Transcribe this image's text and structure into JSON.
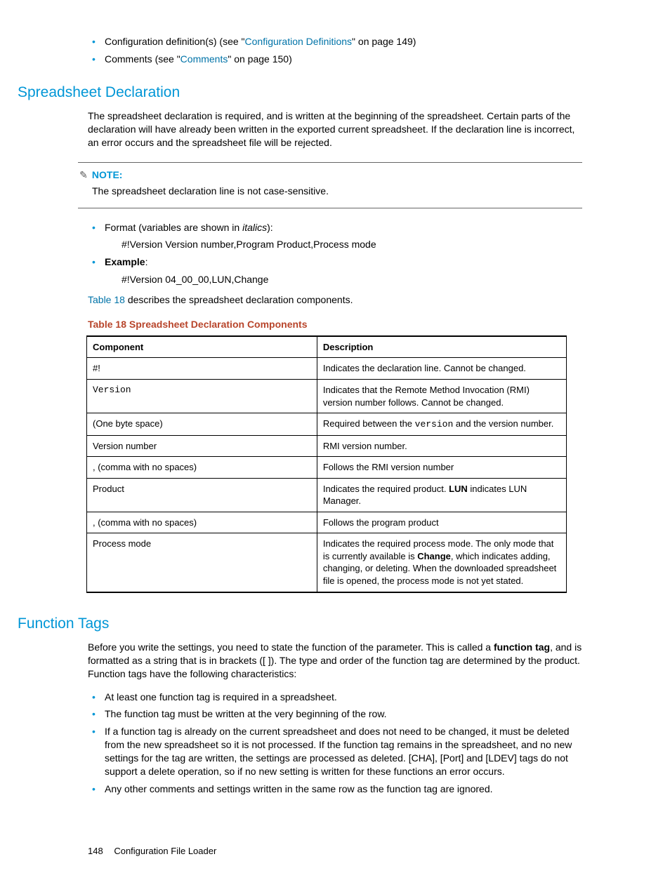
{
  "topList": {
    "item1_pre": "Configuration definition(s) (see \"",
    "item1_link": "Configuration Definitions",
    "item1_post": "\" on page 149)",
    "item2_pre": "Comments (see \"",
    "item2_link": "Comments",
    "item2_post": "\" on page 150)"
  },
  "section1": {
    "title": "Spreadsheet Declaration",
    "para": "The spreadsheet declaration is required, and is written at the beginning of the spreadsheet. Certain parts of the declaration will have already been written in the exported current spreadsheet. If the declaration line is incorrect, an error occurs and the spreadsheet file will be rejected."
  },
  "note": {
    "label": "NOTE:",
    "text": "The spreadsheet declaration line is not case-sensitive."
  },
  "formatList": {
    "item1_pre": "Format (variables are shown in ",
    "item1_italic": "italics",
    "item1_post": "):",
    "item1_sub": "#!Version Version number,Program Product,Process mode",
    "item2_label": "Example",
    "item2_post": ":",
    "item2_sub": "#!Version 04_00_00,LUN,Change"
  },
  "describes": {
    "link": "Table 18",
    "rest": " describes the spreadsheet declaration components."
  },
  "tableTitle": "Table 18 Spreadsheet Declaration Components",
  "table": {
    "h1": "Component",
    "h2": "Description",
    "r1c1": "#!",
    "r1c2": "Indicates the declaration line. Cannot be changed.",
    "r2c1": "Version",
    "r2c2": "Indicates that the Remote Method Invocation (RMI) version number follows. Cannot be changed.",
    "r3c1": "(One byte space)",
    "r3c2_pre": "Required between the ",
    "r3c2_mono": "version",
    "r3c2_post": " and the version number.",
    "r4c1": "Version number",
    "r4c2": "RMI version number.",
    "r5c1": ", (comma with no spaces)",
    "r5c2": "Follows the RMI version number",
    "r6c1": "Product",
    "r6c2_pre": "Indicates the required product. ",
    "r6c2_bold": "LUN",
    "r6c2_post": " indicates LUN Manager.",
    "r7c1": ", (comma with no spaces)",
    "r7c2": "Follows the program product",
    "r8c1": "Process mode",
    "r8c2_pre": "Indicates the required process mode. The only mode that is currently available is ",
    "r8c2_bold": "Change",
    "r8c2_post": ", which indicates adding, changing, or deleting. When the downloaded spreadsheet file is opened, the process mode is not yet stated."
  },
  "section2": {
    "title": "Function Tags",
    "para_pre": "Before you write the settings, you need to state the function of the parameter. This is called a ",
    "para_bold": "function tag",
    "para_post": ", and is formatted as a string that is in brackets ([ ]). The type and order of the function tag are determined by the product. Function tags have the following characteristics:",
    "b1": "At least one function tag is required in a spreadsheet.",
    "b2": "The function tag must be written at the very beginning of the row.",
    "b3": "If a function tag is already on the current spreadsheet and does not need to be changed, it must be deleted from the new spreadsheet so it is not processed. If the function tag remains in the spreadsheet, and no new settings for the tag are written, the settings are processed as deleted. [CHA], [Port] and [LDEV] tags do not support a delete operation, so if no new setting is written for these functions an error occurs.",
    "b4": "Any other comments and settings written in the same row as the function tag are ignored."
  },
  "footer": {
    "page": "148",
    "title": "Configuration File Loader"
  }
}
